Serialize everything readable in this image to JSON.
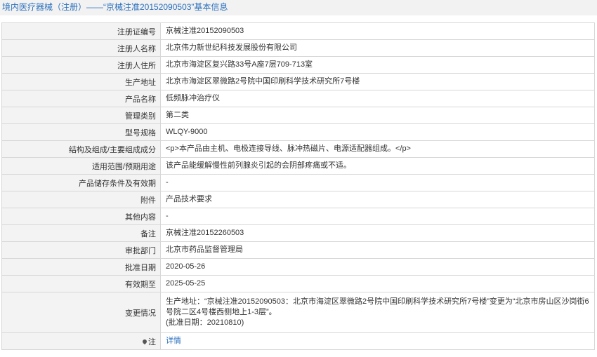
{
  "header": {
    "section": "境内医疗器械（注册）",
    "separator": "——",
    "record_title": "“京械注准20152090503”基本信息"
  },
  "rows": [
    {
      "label": "注册证编号",
      "value": "京械注准20152090503"
    },
    {
      "label": "注册人名称",
      "value": "北京伟力新世纪科技发展股份有限公司"
    },
    {
      "label": "注册人住所",
      "value": "北京市海淀区复兴路33号A座7层709-713室"
    },
    {
      "label": "生产地址",
      "value": "北京市海淀区翠微路2号院中国印刷科学技术研究所7号楼"
    },
    {
      "label": "产品名称",
      "value": "低频脉冲治疗仪"
    },
    {
      "label": "管理类别",
      "value": "第二类"
    },
    {
      "label": "型号规格",
      "value": "WLQY-9000"
    },
    {
      "label": "结构及组成/主要组成成分",
      "value": "<p>本产品由主机、电极连接导线、脉冲热磁片、电源适配器组成。</p>"
    },
    {
      "label": "适用范围/预期用途",
      "value": "该产品能缓解慢性前列腺炎引起的会阴部疼痛或不适。"
    },
    {
      "label": "产品储存条件及有效期",
      "value": "-"
    },
    {
      "label": "附件",
      "value": "产品技术要求"
    },
    {
      "label": "其他内容",
      "value": "-"
    },
    {
      "label": "备注",
      "value": "京械注准20152260503"
    },
    {
      "label": "审批部门",
      "value": "北京市药品监督管理局"
    },
    {
      "label": "批准日期",
      "value": "2020-05-26"
    },
    {
      "label": "有效期至",
      "value": "2025-05-25"
    }
  ],
  "change": {
    "label": "变更情况",
    "line1": "生产地址：“京械注准20152090503：北京市海淀区翠微路2号院中国印刷科学技术研究所7号楼”变更为“北京市房山区沙岗街6号院二区4号楼西侧地上1-3层”。",
    "line2": "(批准日期：20210810)"
  },
  "note": {
    "label": "注",
    "icon": "map-pin-icon",
    "link_text": "详情"
  },
  "colors": {
    "accent": "#2a6fbd",
    "label_bg": "#f3f3f3",
    "border": "#d7d7d7",
    "header_bg": "#f2f2f2"
  }
}
